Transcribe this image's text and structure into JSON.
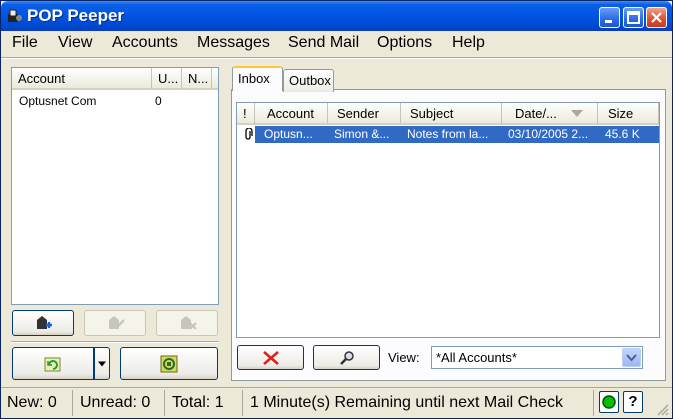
{
  "window": {
    "title": "POP Peeper"
  },
  "menu": [
    "File",
    "View",
    "Accounts",
    "Messages",
    "Send Mail",
    "Options",
    "Help"
  ],
  "accounts_list": {
    "columns": [
      "Account",
      "U...",
      "N..."
    ],
    "rows": [
      {
        "account": "Optusnet Com",
        "unread": "0",
        "new": ""
      }
    ]
  },
  "account_buttons": {
    "add": "add-account-icon",
    "edit": "edit-account-icon",
    "delete": "delete-account-icon",
    "check": "check-mail-icon",
    "check_menu": "chevron-down-icon",
    "stop": "stop-icon"
  },
  "tabs": [
    "Inbox",
    "Outbox"
  ],
  "messages_list": {
    "columns": [
      "!",
      "Account",
      "Sender",
      "Subject",
      "Date/...",
      "Size"
    ],
    "sort_indicator": "sort-down-icon",
    "rows": [
      {
        "flag": "attachment-icon",
        "account": "Optusn...",
        "sender": "Simon &...",
        "subject": "Notes from la...",
        "date": "03/10/2005 2...",
        "size": "45.6 K"
      }
    ]
  },
  "message_buttons": {
    "delete": "delete-icon",
    "find": "find-icon"
  },
  "view": {
    "label": "View:",
    "value": "*All Accounts*"
  },
  "status": {
    "new": "New: 0",
    "unread": "Unread: 0",
    "total": "Total: 1",
    "message": "1 Minute(s) Remaining until next Mail Check",
    "help": "?"
  },
  "colors": {
    "titlebar": "#0054e3",
    "selection": "#316ac5",
    "status_led": "#00c000"
  }
}
